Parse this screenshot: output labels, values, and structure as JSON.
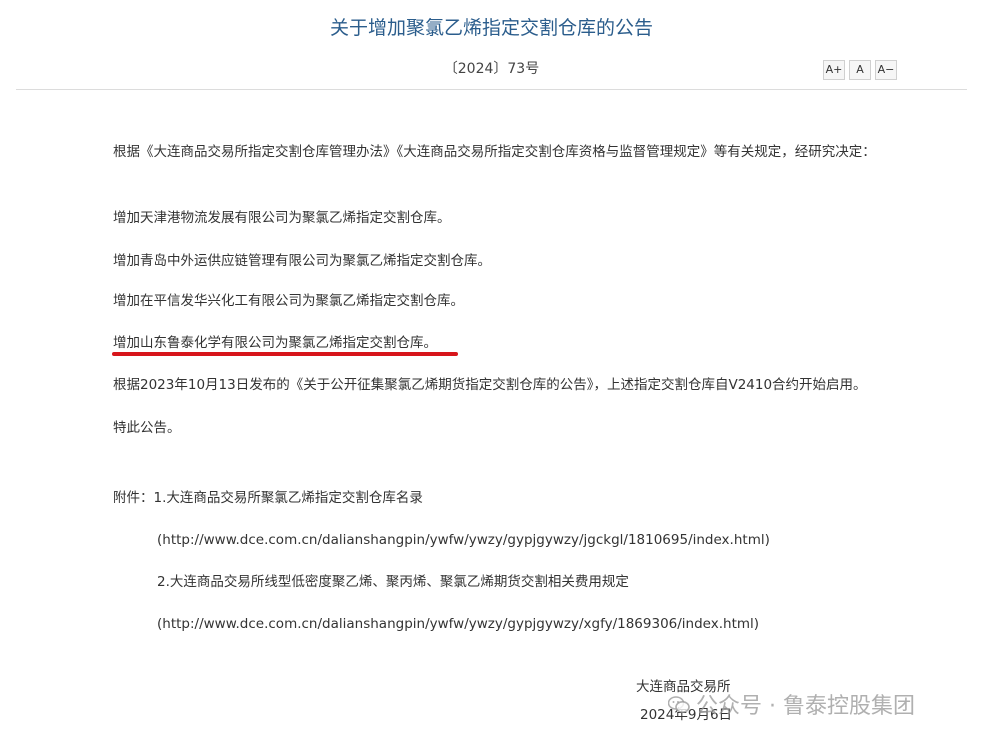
{
  "title": "关于增加聚氯乙烯指定交割仓库的公告",
  "doc_number": "〔2024〕73号",
  "font_controls": {
    "increase": "A+",
    "normal": "A",
    "decrease": "A−"
  },
  "body": {
    "intro": "根据《大连商品交易所指定交割仓库管理办法》《大连商品交易所指定交割仓库资格与监督管理规定》等有关规定，经研究决定：",
    "items": [
      "增加天津港物流发展有限公司为聚氯乙烯指定交割仓库。",
      "增加青岛中外运供应链管理有限公司为聚氯乙烯指定交割仓库。",
      "增加在平信发华兴化工有限公司为聚氯乙烯指定交割仓库。",
      "增加山东鲁泰化学有限公司为聚氯乙烯指定交割仓库。"
    ],
    "basis": "根据2023年10月13日发布的《关于公开征集聚氯乙烯期货指定交割仓库的公告》，上述指定交割仓库自V2410合约开始启用。",
    "closing": "特此公告。"
  },
  "attachments": {
    "label": "附件：1.大连商品交易所聚氯乙烯指定交割仓库名录",
    "link1": "(http://www.dce.com.cn/dalianshangpin/ywfw/ywzy/gypjgywzy/jgckgl/1810695/index.html)",
    "item2": "2.大连商品交易所线型低密度聚乙烯、聚丙烯、聚氯乙烯期货交割相关费用规定",
    "link2": "(http://www.dce.com.cn/dalianshangpin/ywfw/ywzy/gypjgywzy/xgfy/1869306/index.html)"
  },
  "signature": {
    "issuer": "大连商品交易所",
    "date": "2024年9月6日"
  },
  "watermark": {
    "text": "公众号 · 鲁泰控股集团",
    "icon": "wechat-icon"
  },
  "colors": {
    "title": "#2b5d8c",
    "highlight_underline": "#d7151b",
    "text": "#333333"
  }
}
